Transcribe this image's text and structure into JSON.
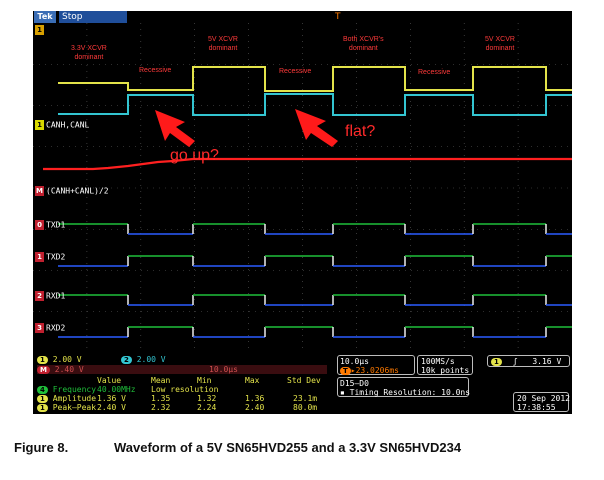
{
  "window": {
    "brand": "Tek",
    "acquisition_state": "Stop",
    "trigger_marker": "T"
  },
  "channels": {
    "ch1_label": "CANH,CANL",
    "math_label": "(CANH+CANL)/2",
    "digital": [
      "TXD1",
      "TXD2",
      "RXD1",
      "RXD2"
    ],
    "digital_tags": [
      "0",
      "1",
      "2",
      "3"
    ]
  },
  "annotations": {
    "dominant_3v3": [
      "3.3V XCVR",
      "dominant"
    ],
    "dominant_5v_1": [
      "5V XCVR",
      "dominant"
    ],
    "dominant_both": [
      "Both XCVR's",
      "dominant"
    ],
    "dominant_5v_2": [
      "5V XCVR",
      "dominant"
    ],
    "recessive": [
      "Recessive",
      "Recessive",
      "Recessive"
    ],
    "go_up": "go up?",
    "flat": "flat?"
  },
  "status": {
    "ch1_scale": "2.00 V",
    "ch2_scale": "2.00 V",
    "math_scale": "2.40 V",
    "math_timebase": "10.0µs",
    "ch_tags": [
      "1",
      "2",
      "M"
    ],
    "timebase": "10.0µs",
    "trigger_pos": "▸23.0206ms",
    "sample_rate": "100MS/s",
    "record_length": "10k points",
    "trigger_channel": "1",
    "trigger_slope": "ʃ",
    "trigger_level": "3.16 V",
    "digital_group": "D15–D0",
    "timing_resolution": "Timing Resolution: 10.0ns",
    "date": "20 Sep 2012",
    "time": "17:38:55",
    "meas_headers": [
      "Value",
      "Mean",
      "Min",
      "Max",
      "Std Dev"
    ],
    "meas_rows": [
      {
        "tag": "4",
        "name": "Frequency",
        "value": "40.00MHz",
        "extra": "Low resolution"
      },
      {
        "tag": "1",
        "name": "Amplitude",
        "value": "1.36 V",
        "mean": "1.35",
        "min": "1.32",
        "max": "1.36",
        "std": "23.1m"
      },
      {
        "tag": "1",
        "name": "Peak–Peak",
        "value": "2.40 V",
        "mean": "2.32",
        "min": "2.24",
        "max": "2.40",
        "std": "80.0m"
      }
    ]
  },
  "caption": {
    "label": "Figure 8.",
    "title": "Waveform of a 5V SN65HVD255 and a 3.3V SN65HVD234"
  },
  "colors": {
    "ch1": "#e3e34a",
    "ch2": "#33c5d1",
    "math": "#ff2020",
    "digital_high": "#1fbf3a",
    "digital_low": "#2a5cff",
    "annotation": "#ff2a2a",
    "arrow": "#ff1a1a"
  }
}
